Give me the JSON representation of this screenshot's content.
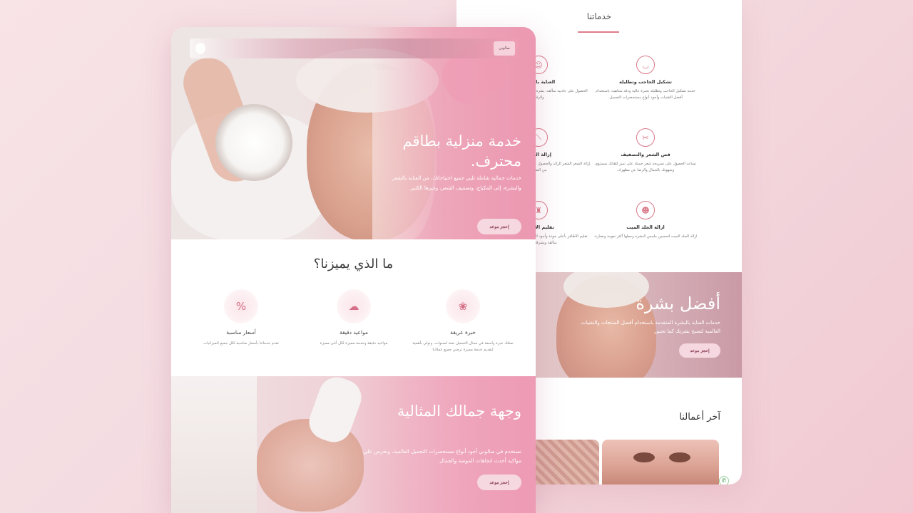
{
  "services": {
    "title": "خدماتنا",
    "items": [
      {
        "title": "تشكيل الحاجب وتظليله",
        "desc": "خدمة تشكيل الحاجب وتظليله بخبرة عالية ودقة متناهية، باستخدام أفضل التقنيات وأجود أنواع مستحضرات التجميل.",
        "icon": "brow"
      },
      {
        "title": "العناية بالبشرة",
        "desc": "الحصول على جاذبية متألقة، بشرة تنبض بنعومة وشهوتك بالجمال والرقة.",
        "icon": "face"
      },
      {
        "title": "قص الشعر والتصفيف",
        "desc": "تساعد الحصول على تسريحة شعر جميلة على تميز للقائك بمستوى وشهوتك بالجمال والرضا عن مظهرك.",
        "icon": "scissors"
      },
      {
        "title": "إزالة الشعر",
        "desc": "إزالة الشعر الشعر الزائد والحصول على بشرة ناعمة الملمس وخالية من الشعر.",
        "icon": "razor"
      },
      {
        "title": "ازالة الجلد الميت",
        "desc": "ازالة الجلد الميت لتحسين ملمس البشرة وجعلها أكثر نعومة ونضارة.",
        "icon": "skin"
      },
      {
        "title": "تقليم الأظافر",
        "desc": "تقليم الأظافر بأعلى جودة وأجود المنتجات للحصول على أظافرك متألقة ويشرفك لجمالها.",
        "icon": "nail"
      }
    ]
  },
  "best_skin": {
    "title": "أفضل بشرة",
    "desc": "خدمات العناية بالبشرة المتقدمة باستخدام أفضل المنتجات والتقنيات العالمية لتصبح بشرتك كما تحبين",
    "button": "إحجز موعد"
  },
  "works": {
    "title": "آخر أعمالنا"
  },
  "nav": {
    "button": "صالوني"
  },
  "hero": {
    "title": "خدمة منزلية بطاقم محترف.",
    "desc": "خدمات جمالية شاملة تلبي جميع احتياجاتك، من العناية بالشعر والبشرة، إلى المكياج، وتصفيف الشعر، وغيرها الكثير.",
    "button": "إحجز موعد"
  },
  "why": {
    "title": "ما الذي يميزنا؟",
    "features": [
      {
        "title": "خبرة عريقة",
        "desc": "نمتلك خبرة واسعة في مجال التجميل تمتد لسنوات، ونولي بأهمية لتقديم خدمة مميزة ترضي جميع عملائنا",
        "icon": "❀"
      },
      {
        "title": "مواعيد دقيقة",
        "desc": "مواعيد دقيقة وخدمة مميزة لكل أنثى مميزة",
        "icon": "☁"
      },
      {
        "title": "أسعار مناسبة",
        "desc": "نقدم خدماتنا بأسعار مناسبة لكل جميع الميزانيات",
        "icon": "%"
      }
    ]
  },
  "hero2": {
    "title": "وجهة جمالك المثالية",
    "desc": "نستخدم في صالوني أجود أنواع مستحضرات التجميل العالمية، ونحرص على مواكبة أحدث اتجاهات الموضة والجمال.",
    "button": "إحجز موعد"
  },
  "colors": {
    "accent": "#e07b8c",
    "button_bg": "#f6d8e0",
    "button_text": "#8a3d52"
  }
}
